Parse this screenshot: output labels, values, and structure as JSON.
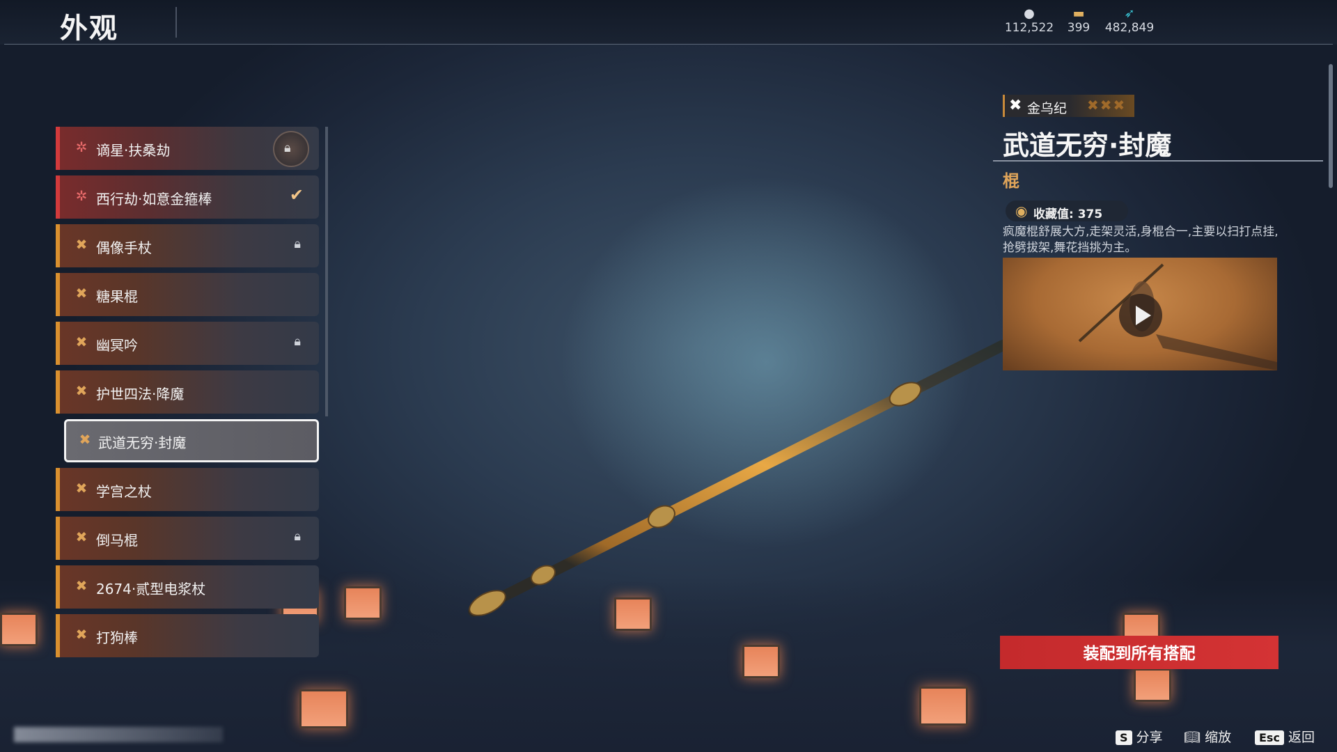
{
  "header": {
    "title": "外观",
    "currencies": [
      {
        "icon": "coin-icon",
        "value": "112,522"
      },
      {
        "icon": "scroll-ticket-icon",
        "value": "399"
      },
      {
        "icon": "feather-icon",
        "value": "482,849"
      }
    ]
  },
  "list": {
    "items": [
      {
        "label": "谪星·扶桑劫",
        "rarity": "red",
        "status": "locked-badge"
      },
      {
        "label": "西行劫·如意金箍棒",
        "rarity": "red",
        "status": "equipped"
      },
      {
        "label": "偶像手杖",
        "rarity": "gold",
        "status": "locked"
      },
      {
        "label": "糖果棍",
        "rarity": "gold",
        "status": "owned"
      },
      {
        "label": "幽冥吟",
        "rarity": "gold",
        "status": "locked"
      },
      {
        "label": "护世四法·降魔",
        "rarity": "gold",
        "status": "owned"
      },
      {
        "label": "武道无穷·封魔",
        "rarity": "gold",
        "status": "selected"
      },
      {
        "label": "学宫之杖",
        "rarity": "gold",
        "status": "owned"
      },
      {
        "label": "倒马棍",
        "rarity": "gold",
        "status": "locked"
      },
      {
        "label": "2674·贰型电浆杖",
        "rarity": "gold",
        "status": "owned"
      },
      {
        "label": "打狗棒",
        "rarity": "gold",
        "status": "owned"
      }
    ]
  },
  "detail": {
    "era": "金乌纪",
    "name": "武道无穷·封魔",
    "type": "棍",
    "collection_label": "收藏值: 375",
    "description": "疯魔棍舒展大方,走架灵活,身棍合一,主要以扫打点挂,抢劈拔架,舞花挡挑为主。",
    "equip_button": "装配到所有搭配"
  },
  "hints": [
    {
      "key": "S",
      "label": "分享"
    },
    {
      "key": "book-icon",
      "label": "缩放"
    },
    {
      "key": "Esc",
      "label": "返回"
    }
  ],
  "colors": {
    "accent_red": "#d23a3c",
    "accent_gold": "#e0a55a",
    "equip_button": "#c42a2c"
  }
}
